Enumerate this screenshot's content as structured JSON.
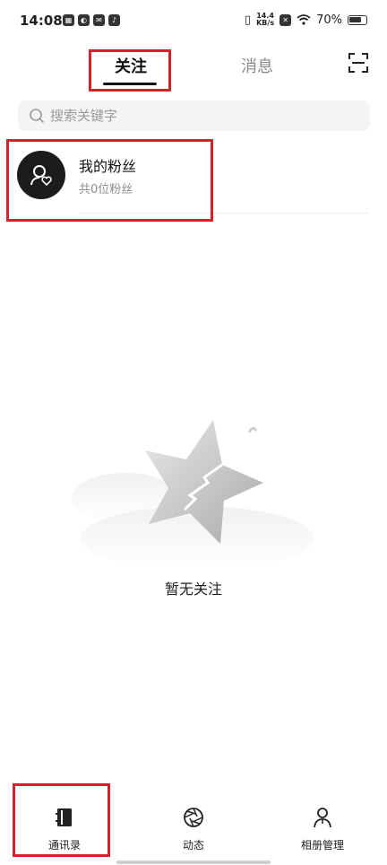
{
  "status_bar": {
    "time": "14:08",
    "net_speed_top": "14.4",
    "net_speed_bottom": "KB/s",
    "battery": "70%"
  },
  "tabs": [
    {
      "label": "关注",
      "active": true
    },
    {
      "label": "消息",
      "active": false
    }
  ],
  "search": {
    "placeholder": "搜索关键字"
  },
  "fans": {
    "title": "我的粉丝",
    "subtitle": "共0位粉丝"
  },
  "empty_state": {
    "text": "暂无关注"
  },
  "bottom_nav": [
    {
      "label": "通讯录",
      "icon": "contacts-book-icon"
    },
    {
      "label": "动态",
      "icon": "aperture-icon"
    },
    {
      "label": "相册管理",
      "icon": "person-icon"
    }
  ],
  "colors": {
    "highlight": "#d8202b",
    "active_text": "#111111",
    "inactive_text": "#8a8a8a"
  }
}
